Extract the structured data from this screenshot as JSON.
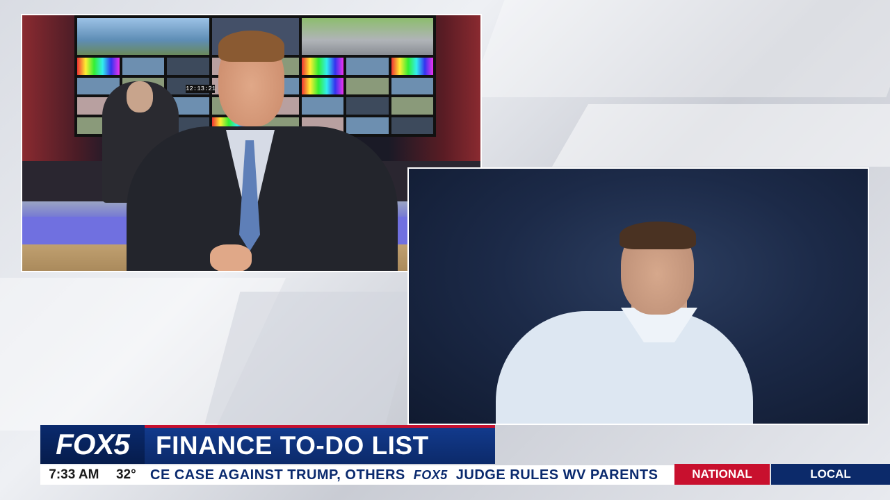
{
  "broadcast": {
    "logo": "FOX5",
    "headline": "FINANCE TO-DO LIST",
    "time": "7:33 AM",
    "temperature": "32°",
    "ticker": {
      "segment_1": "CE CASE AGAINST TRUMP, OTHERS",
      "separator_logo": "FOX5",
      "segment_2": "JUDGE RULES WV PARENTS"
    },
    "tabs": {
      "national": "NATIONAL",
      "local": "LOCAL"
    }
  },
  "studio": {
    "clock": "12:13:21"
  },
  "colors": {
    "brand_blue": "#0c2a6a",
    "brand_red": "#c8102e",
    "ticker_bg": "#ffffff"
  }
}
